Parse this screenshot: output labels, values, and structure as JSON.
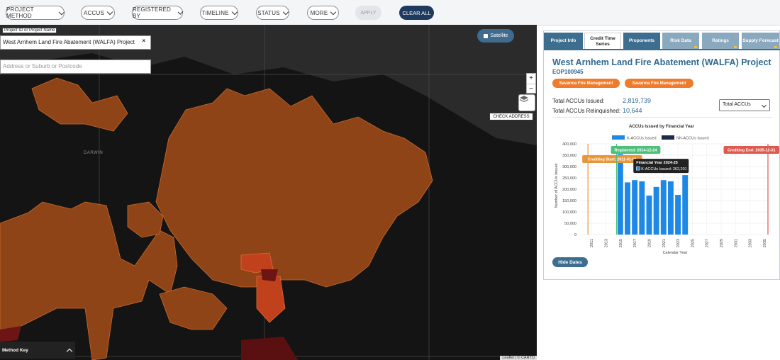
{
  "filters": [
    {
      "label": "PROJECT METHOD"
    },
    {
      "label": "ACCUS"
    },
    {
      "label": "REGISTERED BY"
    },
    {
      "label": "TIMELINE"
    },
    {
      "label": "STATUS"
    },
    {
      "label": "MORE"
    }
  ],
  "apply_label": "APPLY",
  "clear_label": "CLEAR ALL",
  "map": {
    "project_field_label": "Project ID or Project Name",
    "project_value": "West Arnhem Land Fire Abatement (WALFA) Project",
    "address_placeholder": "Address or Suburb or Postcode",
    "satellite_label": "Satellite",
    "check_address_label": "CHECK ADDRESS",
    "zoom_in": "+",
    "zoom_out": "−",
    "method_key_label": "Method Key",
    "place_label": "DARWIN",
    "attribution": "Leaflet | © CARTO",
    "colors": {
      "region": "#8f4418",
      "region_light": "#b45a20",
      "highlight": "#c1411c",
      "water": "#2a2a2a",
      "land": "#151515"
    }
  },
  "panel": {
    "tabs": [
      {
        "label": "Project Info"
      },
      {
        "label": "Credit Time Series"
      },
      {
        "label": "Proponents"
      },
      {
        "label": "Risk Data"
      },
      {
        "label": "Ratings"
      },
      {
        "label": "Supply Forecast"
      }
    ],
    "title": "West Arnhem Land Fire Abatement (WALFA) Project",
    "code": "EOP100945",
    "pills": [
      "Savanna Fire Management",
      "Savanna Fire Management"
    ],
    "total_issued_label": "Total ACCUs Issued:",
    "total_issued_value": "2,819,739",
    "total_relinquished_label": "Total ACCUs Relinquished:",
    "total_relinquished_value": "10,644",
    "select_value": "Total ACCUs",
    "hide_dates_label": "Hide Dates"
  },
  "chart_data": {
    "type": "bar",
    "title": "ACCUs Issued by Financial Year",
    "xlabel": "Calendar Year",
    "ylabel": "Number of ACCUs Issued",
    "ylim": [
      0,
      400000
    ],
    "yticks": [
      "0",
      "50,000",
      "100,000",
      "150,000",
      "200,000",
      "250,000",
      "300,000",
      "350,000",
      "400,000"
    ],
    "xticks": [
      "2011",
      "2013",
      "2015",
      "2017",
      "2019",
      "2021",
      "2023",
      "2025",
      "2027",
      "2029",
      "2031",
      "2033",
      "2035"
    ],
    "xlim": [
      2010,
      2036
    ],
    "legend": [
      "K-ACCUs Issued",
      "NK-ACCUs Issued"
    ],
    "legend_position": "top",
    "series": [
      {
        "name": "K-ACCUs Issued",
        "color": "#1e88e5",
        "x": [
          2015,
          2016,
          2017,
          2018,
          2019,
          2020,
          2021,
          2022,
          2023,
          2024
        ],
        "values": [
          355000,
          230000,
          240000,
          235000,
          172000,
          210000,
          240000,
          235000,
          175000,
          262201
        ]
      },
      {
        "name": "NK-ACCUs Issued",
        "color": "#1f2a4a",
        "x": [],
        "values": []
      }
    ],
    "date_markers": [
      {
        "label": "Registered: 2014-12-24",
        "color": "#4ec07a",
        "x": 2014.98
      },
      {
        "label": "Crediting Start: 2011-01-01",
        "color": "#e8953a",
        "x": 2011.0
      },
      {
        "label": "Crediting End: 2035-12-31",
        "color": "#e0594f",
        "x": 2036.0
      }
    ],
    "tooltip": {
      "title": "Financial Year 2024-25",
      "body": "K-ACCUs Issued: 262,201"
    }
  }
}
